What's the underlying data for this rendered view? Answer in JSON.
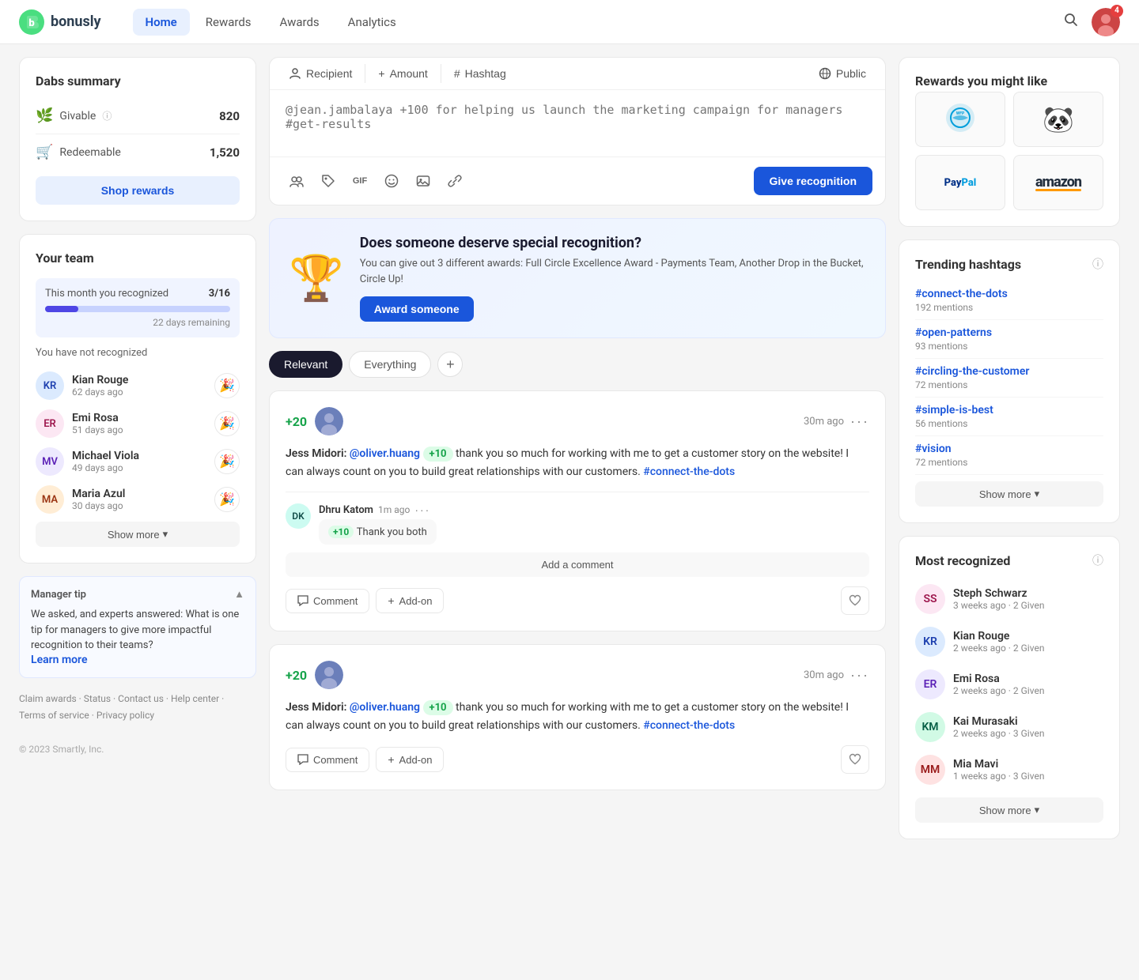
{
  "nav": {
    "logo_text": "bonusly",
    "items": [
      {
        "label": "Home",
        "active": true
      },
      {
        "label": "Rewards",
        "active": false
      },
      {
        "label": "Awards",
        "active": false
      },
      {
        "label": "Analytics",
        "active": false
      }
    ],
    "avatar_badge": "4"
  },
  "left_sidebar": {
    "dabs_summary": {
      "title": "Dabs summary",
      "givable_label": "Givable",
      "givable_value": "820",
      "redeemable_label": "Redeemable",
      "redeemable_value": "1,520",
      "shop_btn": "Shop rewards"
    },
    "your_team": {
      "title": "Your team",
      "this_month_label": "This month you recognized",
      "count": "3/16",
      "progress_pct": 18,
      "days_remaining": "22 days remaining",
      "unrecognized_label": "You have not recognized",
      "members": [
        {
          "name": "Kian Rouge",
          "time": "62 days ago"
        },
        {
          "name": "Emi Rosa",
          "time": "51 days ago"
        },
        {
          "name": "Michael Viola",
          "time": "49 days ago"
        },
        {
          "name": "Maria Azul",
          "time": "30 days ago"
        }
      ],
      "show_more": "Show more"
    },
    "manager_tip": {
      "title": "Manager tip",
      "text": "We asked, and experts answered: What is one tip for managers to give more impactful recognition to their teams?",
      "link_text": "Learn more",
      "collapsed": false
    },
    "footer": {
      "links": [
        "Claim awards",
        "Status",
        "Contact us",
        "Help center",
        "Terms of service",
        "Privacy policy"
      ],
      "copyright": "© 2023 Smartly, Inc."
    }
  },
  "compose": {
    "recipient_label": "Recipient",
    "amount_label": "Amount",
    "hashtag_label": "Hashtag",
    "public_label": "Public",
    "placeholder": "@jean.jambalaya +100 for helping us launch the marketing campaign for managers #get-results",
    "give_btn": "Give recognition"
  },
  "award_banner": {
    "title": "Does someone deserve special recognition?",
    "description": "You can give out 3 different awards: Full Circle Excellence Award - Payments Team, Another Drop in the Bucket, Circle Up!",
    "btn_label": "Award someone"
  },
  "feed": {
    "filters": [
      "Relevant",
      "Everything"
    ],
    "posts": [
      {
        "points": "+20",
        "time": "30m ago",
        "body_author": "Jess Midori:",
        "mention": "@oliver.huang",
        "mention_points": "+10",
        "body_text": " thank you so much for working with me to get a customer story on the website! I can always count on you to build great relationships with our customers.",
        "hashtag": "#connect-the-dots",
        "comment_author_avatar": "DK",
        "comment_author": "Dhru Katom",
        "comment_time": "1m ago",
        "comment_points": "+10",
        "comment_text": "Thank you both",
        "add_comment_label": "Add a comment",
        "comment_btn": "Comment",
        "addon_btn": "Add-on"
      },
      {
        "points": "+20",
        "time": "30m ago",
        "body_author": "Jess Midori:",
        "mention": "@oliver.huang",
        "mention_points": "+10",
        "body_text": " thank you so much for working with me to get a customer story on the website! I can always count on you to build great relationships with our customers.",
        "hashtag": "#connect-the-dots",
        "comment_btn": "Comment",
        "addon_btn": "Add-on"
      }
    ]
  },
  "right_sidebar": {
    "rewards_title": "Rewards you might like",
    "rewards": [
      {
        "name": "WFP",
        "type": "wfp"
      },
      {
        "name": "WWF",
        "type": "wwf"
      },
      {
        "name": "PayPal",
        "type": "paypal"
      },
      {
        "name": "Amazon",
        "type": "amazon"
      }
    ],
    "trending_title": "Trending hashtags",
    "hashtags": [
      {
        "tag": "#connect-the-dots",
        "mentions": "192 mentions"
      },
      {
        "tag": "#open-patterns",
        "mentions": "93 mentions"
      },
      {
        "tag": "#circling-the-customer",
        "mentions": "72 mentions"
      },
      {
        "tag": "#simple-is-best",
        "mentions": "56 mentions"
      },
      {
        "tag": "#vision",
        "mentions": "72 mentions"
      }
    ],
    "hashtags_show_more": "Show more",
    "recognized_title": "Most recognized",
    "recognized": [
      {
        "name": "Steph Schwarz",
        "meta": "3 weeks ago · 2 Given"
      },
      {
        "name": "Kian Rouge",
        "meta": "2 weeks ago · 2 Given"
      },
      {
        "name": "Emi Rosa",
        "meta": "2 weeks ago · 2 Given"
      },
      {
        "name": "Kai Murasaki",
        "meta": "2 weeks ago · 3 Given"
      },
      {
        "name": "Mia Mavi",
        "meta": "1 weeks ago · 3 Given"
      }
    ],
    "recognized_show_more": "Show more"
  }
}
